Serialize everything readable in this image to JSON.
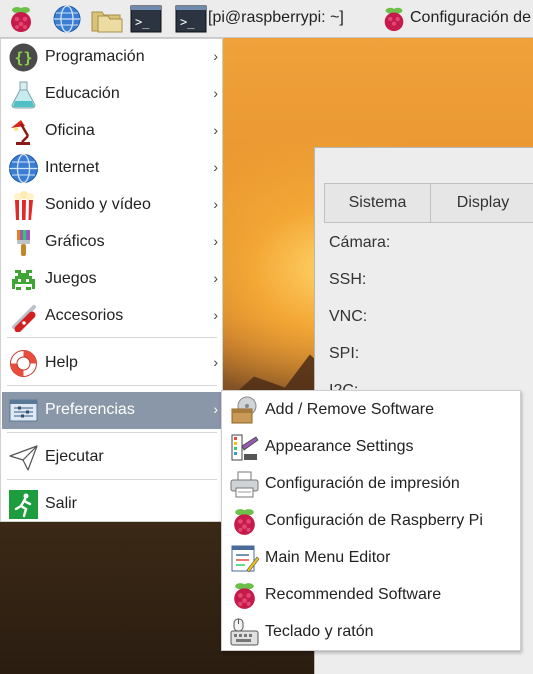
{
  "taskbar": {
    "terminal_title": "[pi@raspberrypi: ~]",
    "config_title": "Configuración de"
  },
  "menu": {
    "items": [
      {
        "label": "Programación",
        "icon": "braces-icon"
      },
      {
        "label": "Educación",
        "icon": "flask-icon"
      },
      {
        "label": "Oficina",
        "icon": "desk-lamp-icon"
      },
      {
        "label": "Internet",
        "icon": "globe-icon"
      },
      {
        "label": "Sonido y vídeo",
        "icon": "popcorn-icon"
      },
      {
        "label": "Gráficos",
        "icon": "paintbrush-icon"
      },
      {
        "label": "Juegos",
        "icon": "space-invader-icon"
      },
      {
        "label": "Accesorios",
        "icon": "swiss-knife-icon"
      },
      {
        "label": "Help",
        "icon": "lifebuoy-icon"
      },
      {
        "label": "Preferencias",
        "icon": "preferences-icon",
        "selected": true
      },
      {
        "label": "Ejecutar",
        "icon": "paper-plane-icon"
      },
      {
        "label": "Salir",
        "icon": "exit-icon"
      }
    ],
    "arrow": "›"
  },
  "submenu": {
    "items": [
      {
        "label": "Add / Remove Software",
        "icon": "package-icon"
      },
      {
        "label": "Appearance Settings",
        "icon": "appearance-icon"
      },
      {
        "label": "Configuración de impresión",
        "icon": "printer-icon"
      },
      {
        "label": "Configuración de Raspberry Pi",
        "icon": "raspberry-icon"
      },
      {
        "label": "Main Menu Editor",
        "icon": "menu-editor-icon"
      },
      {
        "label": "Recommended Software",
        "icon": "raspberry-icon"
      },
      {
        "label": "Teclado y ratón",
        "icon": "keyboard-mouse-icon"
      }
    ]
  },
  "config_window": {
    "tabs": [
      "Sistema",
      "Display"
    ],
    "fields": [
      "Cámara:",
      "SSH:",
      "VNC:",
      "SPI:",
      "I2C:"
    ]
  },
  "colors": {
    "menu_selected": "#8a97a8",
    "raspberry_red": "#c51a4a",
    "leaf_green": "#6cc04a"
  }
}
